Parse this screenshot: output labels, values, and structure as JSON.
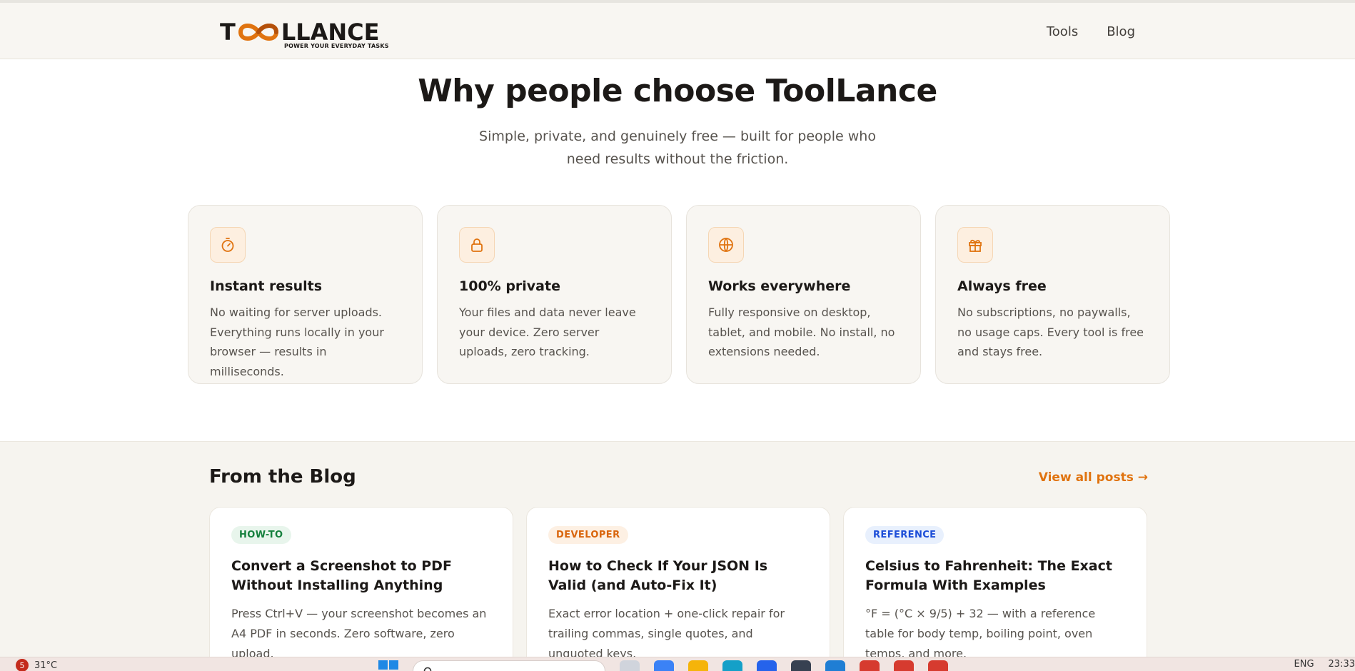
{
  "header": {
    "logo": {
      "word_left": "T",
      "word_right": "LLANCE",
      "tagline": "POWER YOUR EVERYDAY TASKS"
    },
    "nav": [
      {
        "label": "Tools"
      },
      {
        "label": "Blog"
      }
    ]
  },
  "hero": {
    "title": "Why people choose ToolLance",
    "subtitle": "Simple, private, and genuinely free — built for people who need results without the friction."
  },
  "features": [
    {
      "icon": "stopwatch-icon",
      "title": "Instant results",
      "description": "No waiting for server uploads. Everything runs locally in your browser — results in milliseconds."
    },
    {
      "icon": "lock-icon",
      "title": "100% private",
      "description": "Your files and data never leave your device. Zero server uploads, zero tracking."
    },
    {
      "icon": "globe-icon",
      "title": "Works everywhere",
      "description": "Fully responsive on desktop, tablet, and mobile. No install, no extensions needed."
    },
    {
      "icon": "gift-icon",
      "title": "Always free",
      "description": "No subscriptions, no paywalls, no usage caps. Every tool is free and stays free."
    }
  ],
  "blog": {
    "title": "From the Blog",
    "view_all": "View all posts →",
    "posts": [
      {
        "tag": "HOW-TO",
        "tag_color": "#15803d",
        "tag_bg": "#e8f5ec",
        "title": "Convert a Screenshot to PDF Without Installing Anything",
        "excerpt": "Press Ctrl+V — your screenshot becomes an A4 PDF in seconds. Zero software, zero upload."
      },
      {
        "tag": "DEVELOPER",
        "tag_color": "#d9650c",
        "tag_bg": "#fdf0e3",
        "title": "How to Check If Your JSON Is Valid (and Auto-Fix It)",
        "excerpt": "Exact error location + one-click repair for trailing commas, single quotes, and unquoted keys."
      },
      {
        "tag": "REFERENCE",
        "tag_color": "#1d4ed8",
        "tag_bg": "#e8f0fd",
        "title": "Celsius to Fahrenheit: The Exact Formula With Examples",
        "excerpt": "°F = (°C × 9/5) + 32 — with a reference table for body temp, boiling point, oven temps, and more."
      }
    ]
  },
  "taskbar": {
    "weather_badge": "5",
    "temperature": "31°C",
    "language": "ENG",
    "time": "23:33"
  },
  "colors": {
    "accent": "#e0730f",
    "text": "#1c1917",
    "muted": "#57534e",
    "card_bg": "#f8f6f2"
  }
}
